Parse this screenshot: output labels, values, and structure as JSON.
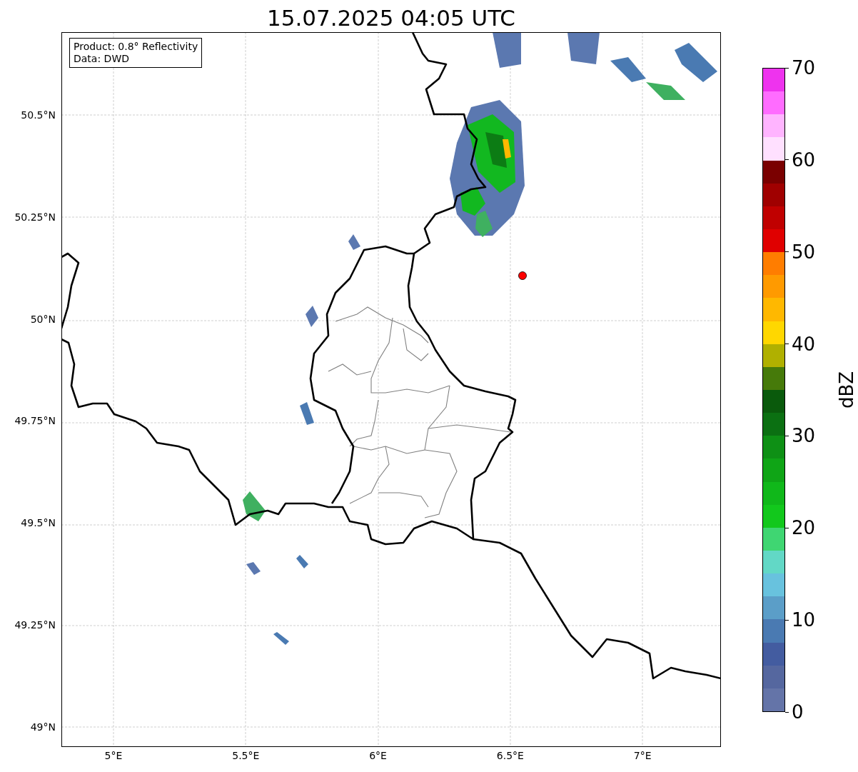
{
  "title": "15.07.2025 04:05 UTC",
  "map": {
    "legend": [
      "Product: 0.8° Reflectivity",
      "Data: DWD"
    ],
    "lat_ticks": [
      "50.5°N",
      "50.25°N",
      "50°N",
      "49.75°N",
      "49.5°N",
      "49.25°N",
      "49°N"
    ],
    "lon_ticks": [
      "5°E",
      "5.5°E",
      "6°E",
      "6.5°E",
      "7°E"
    ]
  },
  "colorbar": {
    "label": "dBZ",
    "ticks": [
      "70",
      "60",
      "50",
      "40",
      "30",
      "20",
      "10",
      "0"
    ],
    "bins": [
      {
        "color": "#6474a8"
      },
      {
        "color": "#55679f"
      },
      {
        "color": "#435ca0"
      },
      {
        "color": "#4a7ab2"
      },
      {
        "color": "#5b9ec8"
      },
      {
        "color": "#68c2de"
      },
      {
        "color": "#62d8c6"
      },
      {
        "color": "#3fd672"
      },
      {
        "color": "#12c81c"
      },
      {
        "color": "#10b81a"
      },
      {
        "color": "#0fa516"
      },
      {
        "color": "#0e9015"
      },
      {
        "color": "#0b7012"
      },
      {
        "color": "#0a5a0c"
      },
      {
        "color": "#467a0a"
      },
      {
        "color": "#b0b000"
      },
      {
        "color": "#ffd700"
      },
      {
        "color": "#ffb800"
      },
      {
        "color": "#ff9a00"
      },
      {
        "color": "#ff7d00"
      },
      {
        "color": "#e00000"
      },
      {
        "color": "#c00000"
      },
      {
        "color": "#a00000"
      },
      {
        "color": "#7a0000"
      },
      {
        "color": "#ffe0ff"
      },
      {
        "color": "#ffb4ff"
      },
      {
        "color": "#ff6cff"
      },
      {
        "color": "#ee33ee"
      }
    ]
  }
}
